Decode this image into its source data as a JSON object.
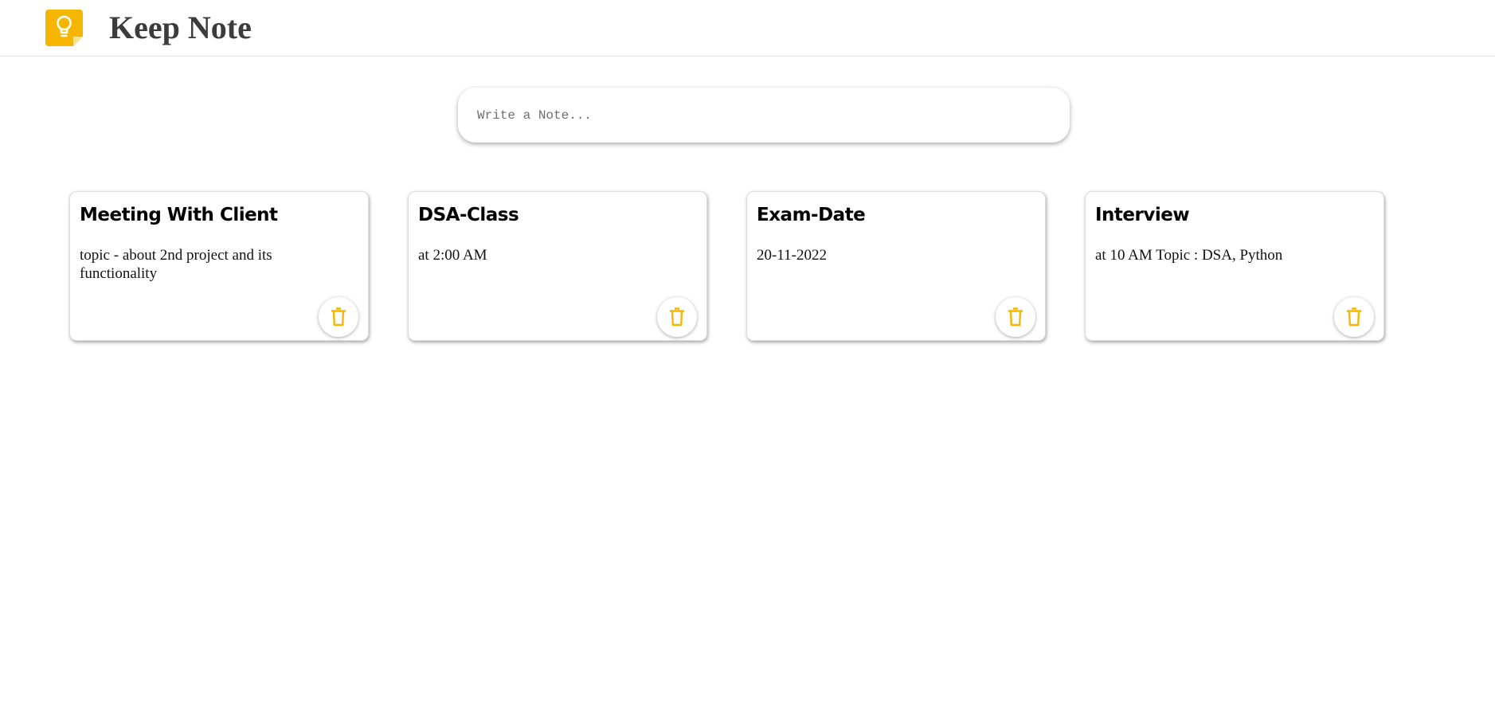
{
  "app": {
    "title": "Keep Note",
    "logo_icon": "lightbulb-icon",
    "accent_color": "#f6b600"
  },
  "composer": {
    "placeholder": "Write a Note...",
    "value": ""
  },
  "notes": [
    {
      "title": "Meeting With Client",
      "body": "topic - about 2nd project and its functionality",
      "action_icon": "trash-icon"
    },
    {
      "title": "DSA-Class",
      "body": "at 2:00 AM",
      "action_icon": "trash-icon"
    },
    {
      "title": "Exam-Date",
      "body": "20-11-2022",
      "action_icon": "trash-icon"
    },
    {
      "title": "Interview",
      "body": "at 10 AM Topic : DSA, Python",
      "action_icon": "trash-icon"
    }
  ]
}
